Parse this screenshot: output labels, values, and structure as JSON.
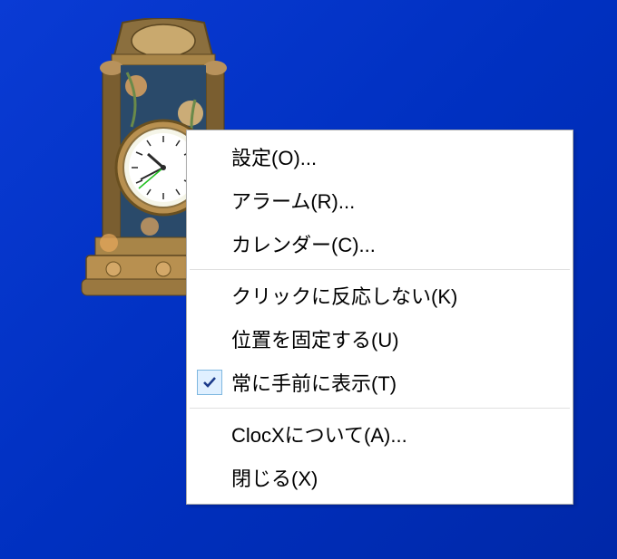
{
  "menu": {
    "items": [
      {
        "label": "設定(O)...",
        "checked": false
      },
      {
        "label": "アラーム(R)...",
        "checked": false
      },
      {
        "label": "カレンダー(C)...",
        "checked": false
      }
    ],
    "items2": [
      {
        "label": "クリックに反応しない(K)",
        "checked": false
      },
      {
        "label": "位置を固定する(U)",
        "checked": false
      },
      {
        "label": "常に手前に表示(T)",
        "checked": true
      }
    ],
    "items3": [
      {
        "label": "ClocXについて(A)...",
        "checked": false
      },
      {
        "label": "閉じる(X)",
        "checked": false
      }
    ]
  }
}
